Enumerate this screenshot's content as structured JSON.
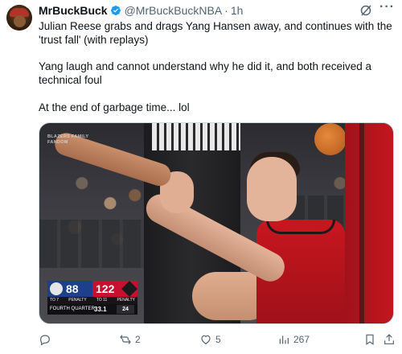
{
  "tweet": {
    "display_name": "MrBuckBuck",
    "handle": "@MrBuckBuckNBA",
    "separator": "·",
    "time": "1h",
    "paragraphs": [
      "Julian Reese grabs and drags Yang Hansen away, and continues with the 'trust fall' (with replays)",
      "Yang laugh and cannot understand why he did it, and both received a technical foul",
      "At the end of garbage time... lol"
    ]
  },
  "media": {
    "camera_logo": "BLAZERS FAMILY FANDOM",
    "scorebug": {
      "away_score": "88",
      "home_score": "122",
      "away_penalty": "PENALTY",
      "away_timeouts": "TO 7",
      "home_timeouts": "TO 11",
      "home_penalty": "PENALTY",
      "quarter": "FOURTH QUARTER",
      "game_clock": "33.1",
      "shot_clock": "24",
      "colors": {
        "away": "#1d3f8c",
        "home": "#c8102e"
      }
    }
  },
  "actions": {
    "replies": "",
    "retweets": "2",
    "likes": "5",
    "views": "267"
  },
  "colors": {
    "text": "#0f1419",
    "secondary": "#536471",
    "verified": "#1d9bf0"
  }
}
